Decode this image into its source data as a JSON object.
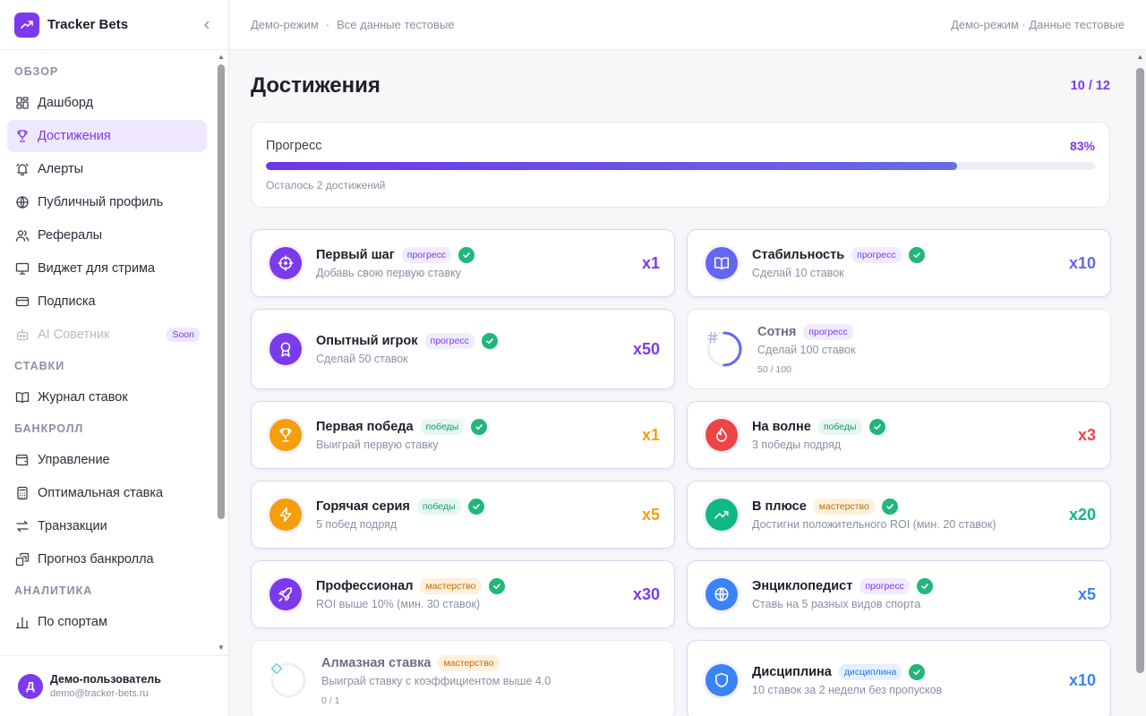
{
  "app": {
    "name": "Tracker Bets"
  },
  "sidebar": {
    "sections": [
      {
        "title": "ОБЗОР",
        "items": [
          {
            "label": "Дашборд",
            "icon": "dashboard-icon",
            "active": false
          },
          {
            "label": "Достижения",
            "icon": "trophy-icon",
            "active": true
          },
          {
            "label": "Алерты",
            "icon": "bell-icon",
            "active": false
          },
          {
            "label": "Публичный профиль",
            "icon": "globe-icon",
            "active": false
          },
          {
            "label": "Рефералы",
            "icon": "users-icon",
            "active": false
          },
          {
            "label": "Виджет для стрима",
            "icon": "monitor-icon",
            "active": false
          },
          {
            "label": "Подписка",
            "icon": "card-icon",
            "active": false
          },
          {
            "label": "AI Советник",
            "icon": "bot-icon",
            "active": false,
            "disabled": true,
            "badge": "Soon"
          }
        ]
      },
      {
        "title": "СТАВКИ",
        "items": [
          {
            "label": "Журнал ставок",
            "icon": "book-icon",
            "active": false
          }
        ]
      },
      {
        "title": "БАНКРОЛЛ",
        "items": [
          {
            "label": "Управление",
            "icon": "wallet-icon",
            "active": false
          },
          {
            "label": "Оптимальная ставка",
            "icon": "calculator-icon",
            "active": false
          },
          {
            "label": "Транзакции",
            "icon": "arrows-icon",
            "active": false
          },
          {
            "label": "Прогноз банкролла",
            "icon": "forecast-icon",
            "active": false
          }
        ]
      },
      {
        "title": "АНАЛИТИКА",
        "items": [
          {
            "label": "По спортам",
            "icon": "bar-chart-icon",
            "active": false
          }
        ]
      }
    ],
    "user": {
      "initial": "Д",
      "name": "Демо-пользователь",
      "email": "demo@tracker-bets.ru"
    }
  },
  "topbar": {
    "mode": "Демо-режим",
    "separator": "·",
    "note": "Все данные тестовые",
    "right": "Демо-режим · Данные тестовые"
  },
  "main": {
    "title": "Достижения",
    "counter": "10 / 12",
    "progress": {
      "label": "Прогресс",
      "percent_label": "83%",
      "value": 0.834,
      "note": "Осталось 2 достижений"
    },
    "achievements": [
      {
        "name": "Первый шаг",
        "tag": "прогресс",
        "tag_type": "progress",
        "desc": "Добавь свою первую ставку",
        "mult": "x1",
        "color": "#7c3aed",
        "icon": "target-icon",
        "done": true
      },
      {
        "name": "Стабильность",
        "tag": "прогресс",
        "tag_type": "progress",
        "desc": "Сделай 10 ставок",
        "mult": "x10",
        "color": "#6366f1",
        "icon": "book-icon",
        "done": true
      },
      {
        "name": "Опытный игрок",
        "tag": "прогресс",
        "tag_type": "progress",
        "desc": "Сделай 50 ставок",
        "mult": "x50",
        "color": "#7c3aed",
        "icon": "medal-icon",
        "done": true
      },
      {
        "name": "Сотня",
        "tag": "прогресс",
        "tag_type": "progress",
        "desc": "Сделай 100 ставок",
        "mult": "",
        "color": "#6366f1",
        "icon": "hash-icon",
        "done": false,
        "progress_text": "50 / 100",
        "ratio": 0.5
      },
      {
        "name": "Первая победа",
        "tag": "победы",
        "tag_type": "wins",
        "desc": "Выиграй первую ставку",
        "mult": "x1",
        "color": "#f59e0b",
        "icon": "trophy-icon",
        "done": true
      },
      {
        "name": "На волне",
        "tag": "победы",
        "tag_type": "wins",
        "desc": "3 победы подряд",
        "mult": "x3",
        "color": "#ef4444",
        "icon": "flame-icon",
        "done": true
      },
      {
        "name": "Горячая серия",
        "tag": "победы",
        "tag_type": "wins",
        "desc": "5 побед подряд",
        "mult": "x5",
        "color": "#f59e0b",
        "icon": "bolt-icon",
        "done": true
      },
      {
        "name": "В плюсе",
        "tag": "мастерство",
        "tag_type": "mastery",
        "desc": "Достигни положительного ROI (мин. 20 ставок)",
        "mult": "x20",
        "color": "#10b981",
        "icon": "trend-up-icon",
        "done": true
      },
      {
        "name": "Профессионал",
        "tag": "мастерство",
        "tag_type": "mastery",
        "desc": "ROI выше 10% (мин. 30 ставок)",
        "mult": "x30",
        "color": "#7c3aed",
        "icon": "rocket-icon",
        "done": true
      },
      {
        "name": "Энциклопедист",
        "tag": "прогресс",
        "tag_type": "progress",
        "desc": "Ставь на 5 разных видов спорта",
        "mult": "x5",
        "color": "#3b82f6",
        "icon": "globe-icon",
        "done": true
      },
      {
        "name": "Алмазная ставка",
        "tag": "мастерство",
        "tag_type": "mastery",
        "desc": "Выиграй ставку с коэффициентом выше 4.0",
        "mult": "",
        "color": "#22c7c7",
        "icon": "diamond-icon",
        "done": false,
        "progress_text": "0 / 1",
        "ratio": 0
      },
      {
        "name": "Дисциплина",
        "tag": "дисциплина",
        "tag_type": "discipline",
        "desc": "10 ставок за 2 недели без пропусков",
        "mult": "x10",
        "color": "#3b82f6",
        "icon": "shield-icon",
        "done": true
      }
    ]
  }
}
